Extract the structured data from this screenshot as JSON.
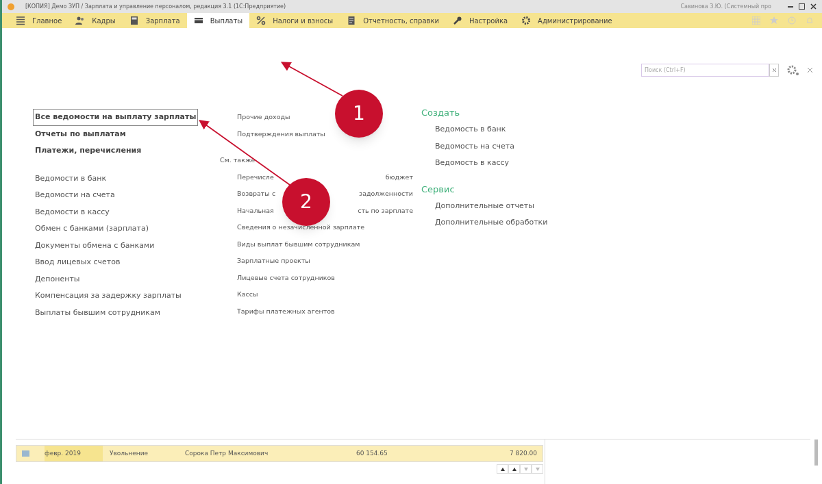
{
  "window": {
    "title": "[КОПИЯ] Демо ЗУП / Зарплата и управление персоналом, редакция 3.1  (1С:Предприятие)",
    "user": "Савинова З.Ю. (Системный про"
  },
  "sections": [
    {
      "label": "Главное",
      "selected": false
    },
    {
      "label": "Кадры",
      "selected": false
    },
    {
      "label": "Зарплата",
      "selected": false
    },
    {
      "label": "Выплаты",
      "selected": true
    },
    {
      "label": "Налоги и взносы",
      "selected": false
    },
    {
      "label": "Отчетность, справки",
      "selected": false
    },
    {
      "label": "Настройка",
      "selected": false
    },
    {
      "label": "Администрирование",
      "selected": false
    }
  ],
  "search": {
    "placeholder": "Поиск (Ctrl+F)"
  },
  "main_links": [
    {
      "text": "Все ведомости на выплату зарплаты",
      "focused": true
    },
    {
      "text": "Отчеты по выплатам",
      "focused": false
    },
    {
      "text": "Платежи, перечисления",
      "focused": false
    }
  ],
  "left_links": [
    "Ведомости в банк",
    "Ведомости на счета",
    "Ведомости в кассу",
    "Обмен с банками (зарплата)",
    "Документы обмена с банками",
    "Ввод лицевых счетов",
    "Депоненты",
    "Компенсация за задержку зарплаты",
    "Выплаты бывшим сотрудникам"
  ],
  "middle_links": [
    {
      "text": "Прочие доходы"
    },
    {
      "text": "Подтверждения выплаты"
    }
  ],
  "see_also": {
    "title": "См. также",
    "links": [
      {
        "text": "Перечисле",
        "tail": "бюджет"
      },
      {
        "text": "Возвраты с",
        "tail": "задолженности"
      },
      {
        "text": "Начальная",
        "tail": "сть по зарплате"
      },
      {
        "text": "Сведения о незачисленной зарплате"
      },
      {
        "text": "Виды выплат бывшим сотрудникам"
      },
      {
        "text": "Зарплатные проекты"
      },
      {
        "text": "Лицевые счета сотрудников"
      },
      {
        "text": "Кассы"
      },
      {
        "text": "Тарифы платежных агентов"
      }
    ]
  },
  "create": {
    "title": "Создать",
    "links": [
      "Ведомость в банк",
      "Ведомость на счета",
      "Ведомость в кассу"
    ]
  },
  "service": {
    "title": "Сервис",
    "links": [
      "Дополнительные отчеты",
      "Дополнительные обработки"
    ]
  },
  "table": {
    "rows": [
      {
        "cells": [
          "февр. 2019",
          "Увольнение",
          "Сорока Петр Максимович",
          "60 154.65",
          "7 820.00"
        ],
        "selected": true
      }
    ]
  },
  "annotations": [
    {
      "label": "1"
    },
    {
      "label": "2"
    }
  ]
}
